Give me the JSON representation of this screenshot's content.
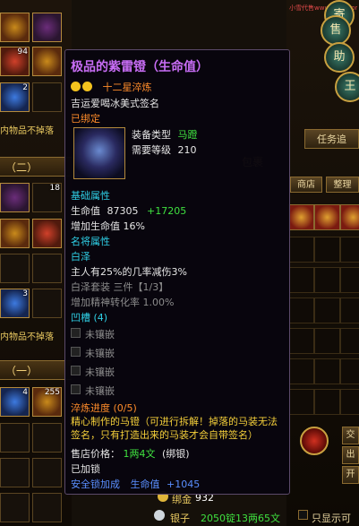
{
  "watermark": "小雪代售www.xxxx.com",
  "left_panel": {
    "counts": [
      "94",
      "2",
      "18",
      "3",
      "4",
      "255"
    ],
    "notice_top": "内物品不掉落",
    "section_two": "（二）",
    "notice_mid": "内物品不掉落",
    "section_one": "（一）"
  },
  "right_panel": {
    "circle_buttons": [
      "寄",
      "售",
      "助",
      "王"
    ],
    "task_button": "任务追",
    "header": "包裹",
    "tabs": [
      "商店",
      "整理"
    ],
    "side_buttons": [
      "交",
      "出",
      "开"
    ]
  },
  "bottom": {
    "bound_gold_label": "绑金",
    "bound_gold_value": "932",
    "silver_label": "银子",
    "silver_value": "2050锭13两65文",
    "only_show_label": "只显示可"
  },
  "tooltip": {
    "title": "极品的紫雷镫（生命值）",
    "stars": "十二星淬炼",
    "signature": "吉运爱喝冰美式签名",
    "bound": "已绑定",
    "equip_type_label": "装备类型",
    "equip_type_value": "马蹬",
    "level_label": "需要等级",
    "level_value": "210",
    "base_attr_header": "基础属性",
    "hp_label": "生命值",
    "hp_value": "87305",
    "hp_bonus": "+17205",
    "hp_pct": "增加生命值 16%",
    "famous_header": "名将属性",
    "baize": "白泽",
    "baize_effect": "主人有25%的几率减伤3%",
    "baize_set": "白泽套装  三件【1/3】",
    "spirit_rate": "增加精神转化率 1.00%",
    "slot_header": "凹槽 (4)",
    "sockets": [
      "未镶嵌",
      "未镶嵌",
      "未镶嵌",
      "未镶嵌"
    ],
    "refine_progress": "淬炼进度 (0/5)",
    "desc": "精心制作的马镫（可进行拆解！掉落的马装无法签名，只有打造出来的马装才会自带签名）",
    "sell_label": "售店价格：",
    "sell_value": "1两4文",
    "sell_bound": "(绑银)",
    "locked": "已加锁",
    "safe_lock": "安全锁加成",
    "safe_lock_attr": "生命值",
    "safe_lock_value": "+1045"
  }
}
